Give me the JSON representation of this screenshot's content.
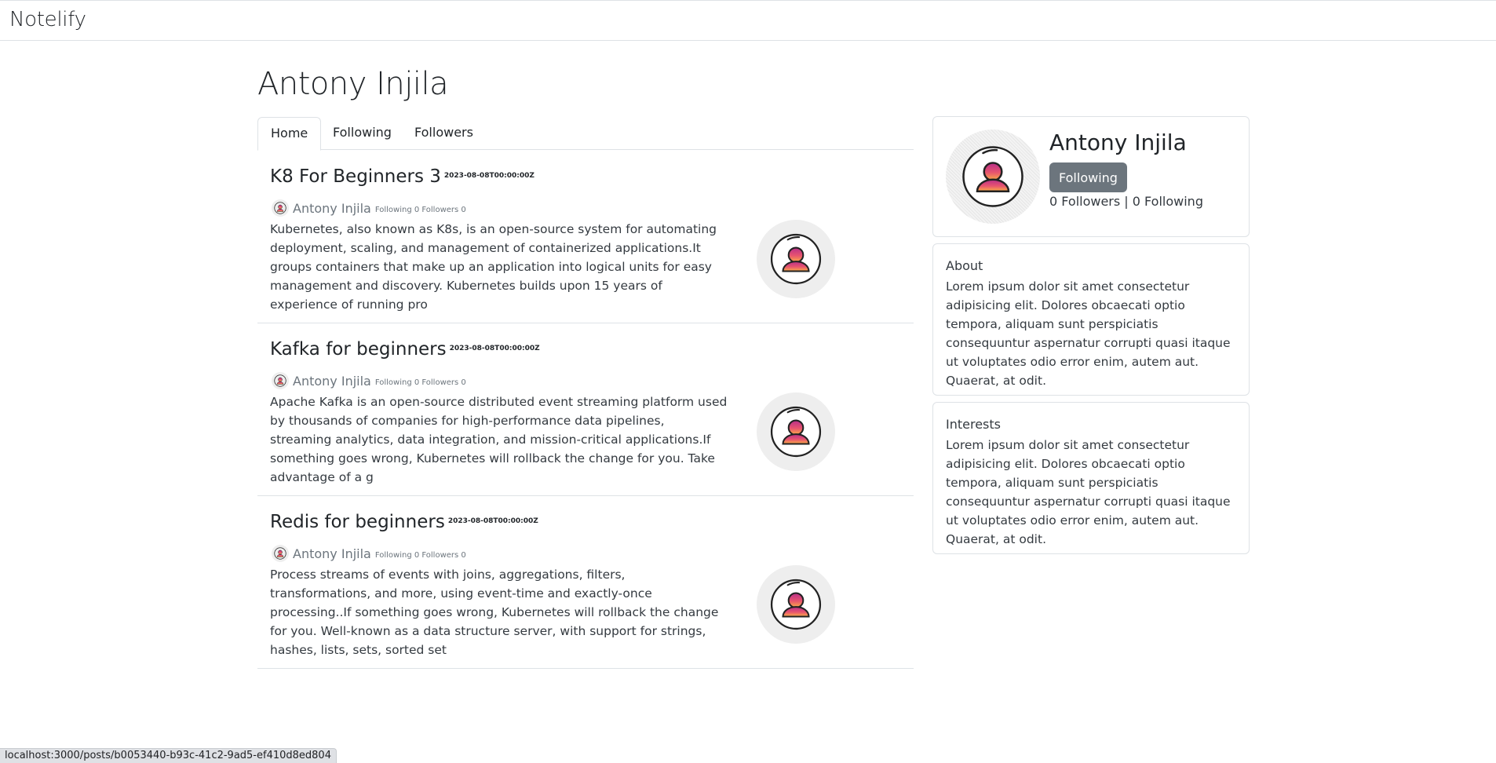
{
  "navbar": {
    "brand": "Notelify"
  },
  "page": {
    "title": "Antony Injila"
  },
  "tabs": [
    {
      "label": "Home",
      "active": true
    },
    {
      "label": "Following",
      "active": false
    },
    {
      "label": "Followers",
      "active": false
    }
  ],
  "posts": [
    {
      "title": "K8 For Beginners 3",
      "date": "2023-08-08T00:00:00Z",
      "author": "Antony Injila",
      "author_meta": "Following 0 Followers 0",
      "excerpt": "Kubernetes, also known as K8s, is an open-source system for automating deployment, scaling, and management of containerized applications.It groups containers that make up an application into logical units for easy management and discovery. Kubernetes builds upon 15 years of experience of running pro",
      "thumbnail_icon": "user-avatar-icon"
    },
    {
      "title": "Kafka for beginners",
      "date": "2023-08-08T00:00:00Z",
      "author": "Antony Injila",
      "author_meta": "Following 0 Followers 0",
      "excerpt": "Apache Kafka is an open-source distributed event streaming platform used by thousands of companies for high-performance data pipelines, streaming analytics, data integration, and mission-critical applications.If something goes wrong, Kubernetes will rollback the change for you. Take advantage of a g",
      "thumbnail_icon": "user-avatar-icon"
    },
    {
      "title": "Redis for beginners",
      "date": "2023-08-08T00:00:00Z",
      "author": "Antony Injila",
      "author_meta": "Following 0 Followers 0",
      "excerpt": "Process streams of events with joins, aggregations, filters, transformations, and more, using event-time and exactly-once processing..If something goes wrong, Kubernetes will rollback the change for you. Well-known as a data structure server, with support for strings, hashes, lists, sets, sorted set",
      "thumbnail_icon": "user-avatar-icon"
    }
  ],
  "profile": {
    "name": "Antony Injila",
    "follow_button": "Following",
    "stats": "0 Followers | 0 Following",
    "avatar_icon": "user-avatar-icon"
  },
  "about": {
    "heading": "About",
    "text": "Lorem ipsum dolor sit amet consectetur adipisicing elit. Dolores obcaecati optio tempora, aliquam sunt perspiciatis consequuntur aspernatur corrupti quasi itaque ut voluptates odio error enim, autem aut. Quaerat, at odit."
  },
  "interests": {
    "heading": "Interests",
    "text": "Lorem ipsum dolor sit amet consectetur adipisicing elit. Dolores obcaecati optio tempora, aliquam sunt perspiciatis consequuntur aspernatur corrupti quasi itaque ut voluptates odio error enim, autem aut. Quaerat, at odit."
  },
  "status_bar": {
    "url": "localhost:3000/posts/b0053440-b93c-41c2-9ad5-ef410d8ed804"
  },
  "colors": {
    "button_bg": "#6c757d",
    "muted_text": "#6c757d",
    "border": "#dee2e6",
    "avatar_gradient_top": "#c13584",
    "avatar_gradient_bottom": "#fcaf45"
  }
}
